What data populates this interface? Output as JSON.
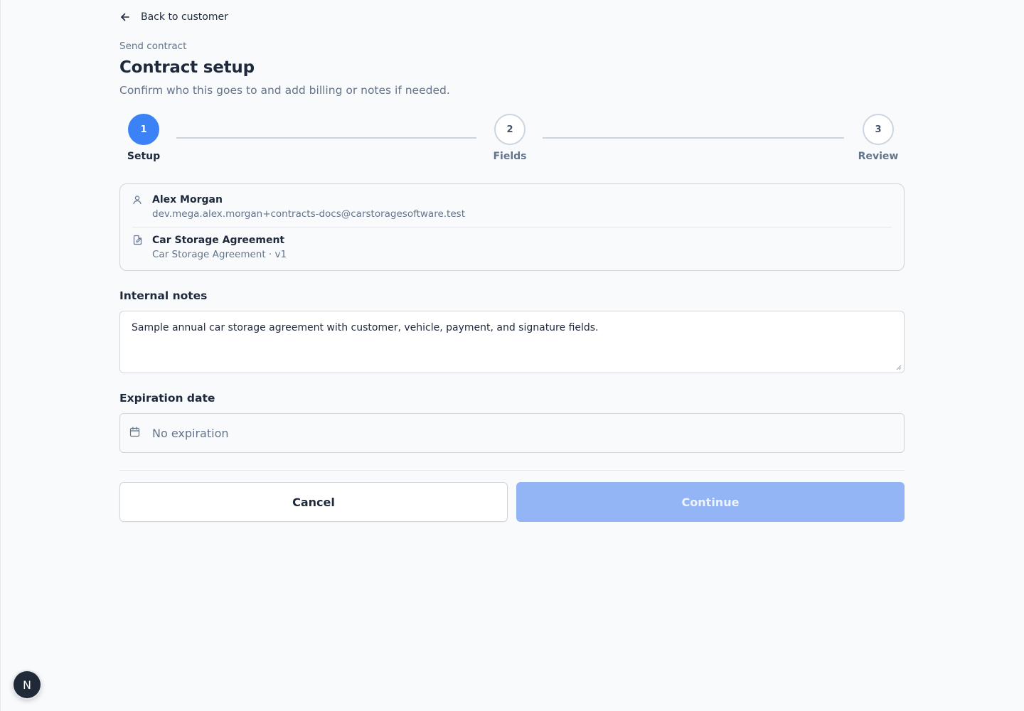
{
  "nav": {
    "back_label": "Back to customer"
  },
  "header": {
    "eyebrow": "Send contract",
    "title": "Contract setup",
    "subtitle": "Confirm who this goes to and add billing or notes if needed."
  },
  "steps": [
    {
      "number": "1",
      "label": "Setup",
      "state": "active"
    },
    {
      "number": "2",
      "label": "Fields",
      "state": "inactive"
    },
    {
      "number": "3",
      "label": "Review",
      "state": "inactive"
    }
  ],
  "recipient": {
    "icon": "user-icon",
    "name": "Alex Morgan",
    "email": "dev.mega.alex.morgan+contracts-docs@carstoragesoftware.test"
  },
  "template": {
    "icon": "document-edit-icon",
    "name": "Car Storage Agreement",
    "detail": "Car Storage Agreement · v1"
  },
  "notes": {
    "label": "Internal notes",
    "value": "Sample annual car storage agreement with customer, vehicle, payment, and signature fields."
  },
  "expiration": {
    "label": "Expiration date",
    "icon": "calendar-icon",
    "value": "No expiration"
  },
  "actions": {
    "cancel_label": "Cancel",
    "continue_label": "Continue"
  },
  "dev_badge": {
    "label": "N",
    "icon": "nextjs-icon"
  },
  "colors": {
    "accent": "#3b82f6",
    "accent_disabled": "#93b4f5",
    "text": "#1e293b",
    "muted": "#64748b",
    "border": "#d1d5db"
  }
}
